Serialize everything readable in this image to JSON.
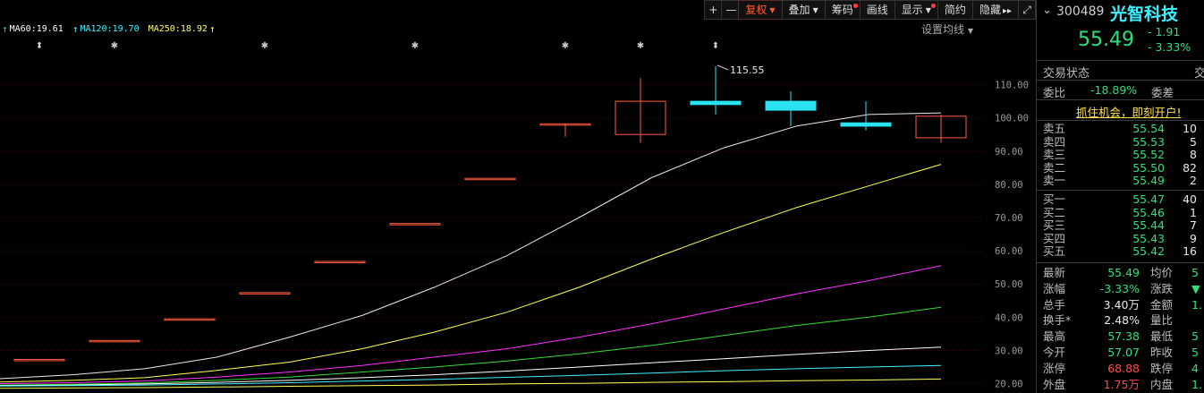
{
  "toolbar": {
    "plus": "+",
    "minus": "—",
    "fuquan": "复权",
    "diejia": "叠加",
    "chouma": "筹码",
    "huaxian": "画线",
    "xianshi": "显示",
    "jianyue": "简约",
    "yincang": "隐藏",
    "yincang_arrows": "▸▸",
    "expand_icon": "⤢"
  },
  "ma_legend": {
    "items": [
      {
        "label": "MA60:19.61",
        "color": "#ffffff"
      },
      {
        "label": "MA120:19.70",
        "color": "#3ff0ff"
      },
      {
        "label": "MA250:18.92",
        "color": "#ffff66"
      }
    ],
    "settings": "设置均线"
  },
  "chart": {
    "y_ticks": [
      "110.00",
      "100.00",
      "90.00",
      "80.00",
      "70.00",
      "60.00",
      "50.00",
      "40.00",
      "30.00",
      "20.00"
    ],
    "annotation_price": "115.55",
    "colors": {
      "up": "#ff5c3c",
      "down": "#29e4f0",
      "ma_white": "#e8e8e8",
      "ma_yellow": "#ffff55",
      "ma_magenta": "#ff30ff",
      "ma_green": "#33dd33",
      "grid": "#3a1010"
    }
  },
  "chart_data": {
    "type": "candlestick",
    "y_axis_ticks": [
      110,
      100,
      90,
      80,
      70,
      60,
      50,
      40,
      30,
      20
    ],
    "y_range": [
      18,
      122
    ],
    "annotation": {
      "label": "115.55",
      "value": 115.55
    },
    "candles": [
      {
        "open": 27.3,
        "close": 27.3,
        "high": 27.3,
        "low": 27.3
      },
      {
        "open": 33.0,
        "close": 33.0,
        "high": 33.0,
        "low": 33.0
      },
      {
        "open": 39.5,
        "close": 39.5,
        "high": 39.5,
        "low": 39.5
      },
      {
        "open": 47.4,
        "close": 47.4,
        "high": 47.4,
        "low": 47.4
      },
      {
        "open": 56.8,
        "close": 56.8,
        "high": 56.8,
        "low": 56.8
      },
      {
        "open": 68.2,
        "close": 68.2,
        "high": 68.2,
        "low": 68.2
      },
      {
        "open": 81.8,
        "close": 81.8,
        "high": 81.8,
        "low": 81.8
      },
      {
        "open": 98.2,
        "close": 98.2,
        "high": 98.2,
        "low": 94.3
      },
      {
        "open": 95.0,
        "close": 105.0,
        "high": 112.0,
        "low": 92.5
      },
      {
        "open": 105.0,
        "close": 104.0,
        "high": 115.55,
        "low": 101.0
      },
      {
        "open": 105.0,
        "close": 102.3,
        "high": 108.0,
        "low": 97.5
      },
      {
        "open": 98.5,
        "close": 97.5,
        "high": 105.0,
        "low": 96.3
      },
      {
        "open": 94.0,
        "close": 100.5,
        "high": 101.0,
        "low": 92.5
      }
    ],
    "series": [
      {
        "name": "white",
        "values": [
          21.5,
          22.7,
          24.5,
          28.0,
          34.0,
          40.5,
          49.0,
          58.5,
          70.0,
          82.0,
          91.0,
          97.5,
          101.0,
          101.5
        ]
      },
      {
        "name": "yellow",
        "values": [
          20.5,
          21.0,
          21.8,
          24.0,
          26.5,
          30.5,
          35.5,
          41.5,
          49.0,
          57.5,
          65.5,
          73.0,
          79.5,
          86.0
        ]
      },
      {
        "name": "magenta",
        "values": [
          20.0,
          20.3,
          20.8,
          22.0,
          23.5,
          25.5,
          28.0,
          30.5,
          34.0,
          38.0,
          42.5,
          47.0,
          51.0,
          55.5
        ]
      },
      {
        "name": "green",
        "values": [
          19.6,
          19.8,
          20.2,
          21.0,
          22.0,
          23.5,
          25.0,
          26.8,
          29.0,
          31.5,
          34.5,
          37.5,
          40.0,
          43.0
        ]
      },
      {
        "name": "MA60",
        "values": [
          19.4,
          19.6,
          19.9,
          20.4,
          21.0,
          21.8,
          22.7,
          23.8,
          25.0,
          26.3,
          27.5,
          28.8,
          30.0,
          31.0
        ]
      },
      {
        "name": "MA120",
        "values": [
          19.3,
          19.4,
          19.6,
          19.9,
          20.3,
          20.8,
          21.3,
          21.9,
          22.5,
          23.2,
          23.9,
          24.5,
          25.0,
          25.5
        ]
      },
      {
        "name": "MA250",
        "values": [
          18.6,
          18.7,
          18.8,
          19.0,
          19.2,
          19.4,
          19.6,
          19.9,
          20.1,
          20.4,
          20.6,
          20.9,
          21.1,
          21.4
        ]
      }
    ]
  },
  "panel": {
    "code": "300489",
    "name": "光智科技",
    "price": "55.49",
    "change": "- 1.91",
    "change_pct": "- 3.33%",
    "trade_status": "交易状态",
    "trade_status_right": "交",
    "weibi_label": "委比",
    "weibi_value": "-18.89%",
    "weicha_label": "委差",
    "weicha_value": "",
    "promo": "抓住机会，即刻开户!",
    "sells": [
      {
        "label": "卖五",
        "price": "55.54",
        "vol": "10"
      },
      {
        "label": "卖四",
        "price": "55.53",
        "vol": "5"
      },
      {
        "label": "卖三",
        "price": "55.52",
        "vol": "8"
      },
      {
        "label": "卖二",
        "price": "55.50",
        "vol": "82"
      },
      {
        "label": "卖一",
        "price": "55.49",
        "vol": "2"
      }
    ],
    "buys": [
      {
        "label": "买一",
        "price": "55.47",
        "vol": "40"
      },
      {
        "label": "买二",
        "price": "55.46",
        "vol": "1"
      },
      {
        "label": "买三",
        "price": "55.44",
        "vol": "7"
      },
      {
        "label": "买四",
        "price": "55.43",
        "vol": "9"
      },
      {
        "label": "买五",
        "price": "55.42",
        "vol": "16"
      }
    ],
    "quotes": [
      {
        "l1": "最新",
        "v1": "55.49",
        "c1": "green",
        "l2": "均价",
        "v2": "5"
      },
      {
        "l1": "涨幅",
        "v1": "-3.33%",
        "c1": "green",
        "l2": "涨跌",
        "v2": "▼"
      },
      {
        "l1": "总手",
        "v1": "3.40万",
        "c1": "white",
        "l2": "金额",
        "v2": "1."
      },
      {
        "l1": "换手*",
        "v1": "2.48%",
        "c1": "white",
        "l2": "量比",
        "v2": ""
      },
      {
        "l1": "最高",
        "v1": "57.38",
        "c1": "green",
        "l2": "最低",
        "v2": "5"
      },
      {
        "l1": "今开",
        "v1": "57.07",
        "c1": "green",
        "l2": "昨收",
        "v2": "5"
      },
      {
        "l1": "涨停",
        "v1": "68.88",
        "c1": "red",
        "l2": "跌停",
        "v2": "4"
      },
      {
        "l1": "外盘",
        "v1": "1.75万",
        "c1": "red",
        "l2": "内盘",
        "v2": "1."
      }
    ]
  }
}
